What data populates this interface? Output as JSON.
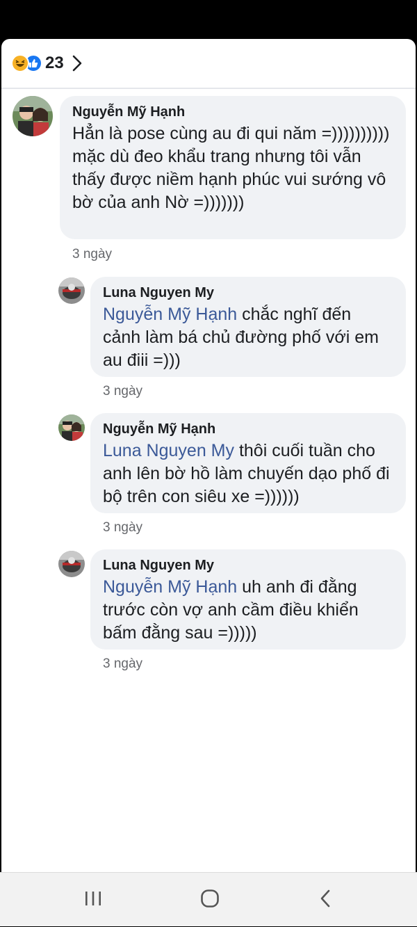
{
  "reactions": {
    "count": "23"
  },
  "comments": [
    {
      "author": "Nguyễn Mỹ Hạnh",
      "mention": "",
      "text": "Hẳn là pose cùng au đi qui năm =)))))))))) mặc dù đeo khẩu trang nhưng tôi vẫn thấy được niềm hạnh phúc vui sướng vô bờ của anh Nờ =)))))))",
      "time": "3 ngày"
    },
    {
      "author": "Luna Nguyen My",
      "mention": "Nguyễn Mỹ Hạnh",
      "text": " chắc nghĩ đến cảnh làm bá chủ đường phố với em au điii =)))",
      "time": "3 ngày"
    },
    {
      "author": "Nguyễn Mỹ Hạnh",
      "mention": "Luna Nguyen My",
      "text": " thôi cuối tuần cho anh lên bờ hồ làm chuyến dạo phố đi bộ trên con siêu xe =))))))",
      "time": "3 ngày"
    },
    {
      "author": "Luna Nguyen My",
      "mention": "Nguyễn Mỹ Hạnh",
      "text": " uh anh đi đằng trước còn vợ anh cầm điều khiển bấm đằng sau =)))))",
      "time": "3 ngày"
    }
  ],
  "icons": {
    "haha": "haha-reaction-icon",
    "like": "like-reaction-icon",
    "recent_apps": "recent-apps-icon",
    "home": "home-icon",
    "back": "back-icon"
  },
  "colors": {
    "mention": "#3b5998",
    "bubble": "#f0f2f5",
    "like": "#1877f2",
    "haha": "#f7b125"
  }
}
